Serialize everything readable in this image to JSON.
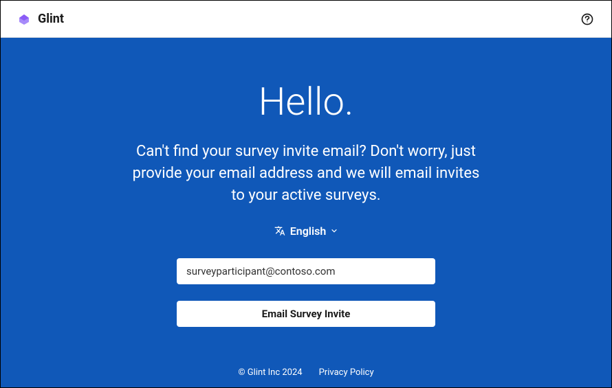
{
  "header": {
    "brand_name": "Glint"
  },
  "main": {
    "hello": "Hello.",
    "subtitle": "Can't find your survey invite email? Don't worry, just provide your email address and we will email invites to your active surveys.",
    "language": "English",
    "email_value": "surveyparticipant@contoso.com",
    "submit_label": "Email Survey Invite"
  },
  "footer": {
    "copyright": "© Glint Inc 2024",
    "privacy_label": "Privacy Policy"
  },
  "colors": {
    "primary_blue": "#1058b8",
    "brand_purple": "#8b5cf6"
  }
}
